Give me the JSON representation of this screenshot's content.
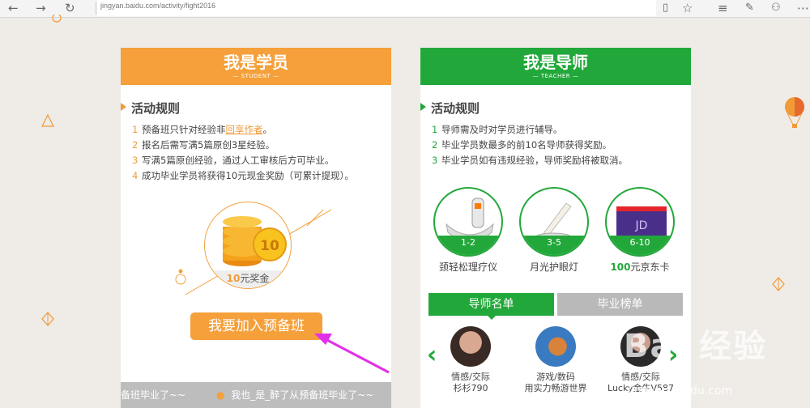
{
  "browser": {
    "back_icon": "arrow-left-icon",
    "forward_icon": "arrow-right-icon",
    "refresh_icon": "refresh-icon",
    "url": "jingyan.baidu.com/activity/fight2016"
  },
  "student": {
    "title": "我是学员",
    "subtitle": "— STUDENT —",
    "rules_title": "活动规则",
    "rules": [
      {
        "n": "1",
        "pre": "预备班只针对经验非",
        "link": "回享作者",
        "post": "。"
      },
      {
        "n": "2",
        "text": "报名后需写满5篇原创3星经验。"
      },
      {
        "n": "3",
        "text": "写满5篇原创经验，通过人工审核后方可毕业。"
      },
      {
        "n": "4",
        "text": "成功毕业学员将获得10元现金奖励（可累计提现）。"
      }
    ],
    "coin_value": "10",
    "prize_amount": "10",
    "prize_suffix": "元奖金",
    "join_button": "我要加入预备班",
    "ticker_1": "备班毕业了~~",
    "ticker_2": "我也_是_醉了从预备班毕业了~~"
  },
  "teacher": {
    "title": "我是导师",
    "subtitle": "— TEACHER —",
    "rules_title": "活动规则",
    "rules": [
      {
        "n": "1",
        "text": "导师需及时对学员进行辅导。"
      },
      {
        "n": "2",
        "text": "毕业学员数最多的前10名导师获得奖励。"
      },
      {
        "n": "3",
        "text": "毕业学员如有违规经验，导师奖励将被取消。"
      }
    ],
    "prizes": [
      {
        "rank": "1-2",
        "caption": "颈轻松理疗仪"
      },
      {
        "rank": "3-5",
        "caption": "月光护眼灯"
      },
      {
        "rank": "6-10",
        "caption_bold": "100",
        "caption": "元京东卡"
      }
    ],
    "card_brand": "JD",
    "tabs": [
      "导师名单",
      "毕业榜单"
    ],
    "mentors": [
      {
        "category": "情感/交际",
        "name": "杉杉790"
      },
      {
        "category": "游戏/数码",
        "name": "用实力畅游世界"
      },
      {
        "category": "情感/交际",
        "name": "Lucky金牛V587"
      }
    ]
  },
  "watermark": {
    "brand": "Bai 经验",
    "url": "jingyan.baidu.com"
  },
  "colors": {
    "orange": "#f5a03a",
    "green": "#22a83a",
    "bg": "#efebe6"
  }
}
